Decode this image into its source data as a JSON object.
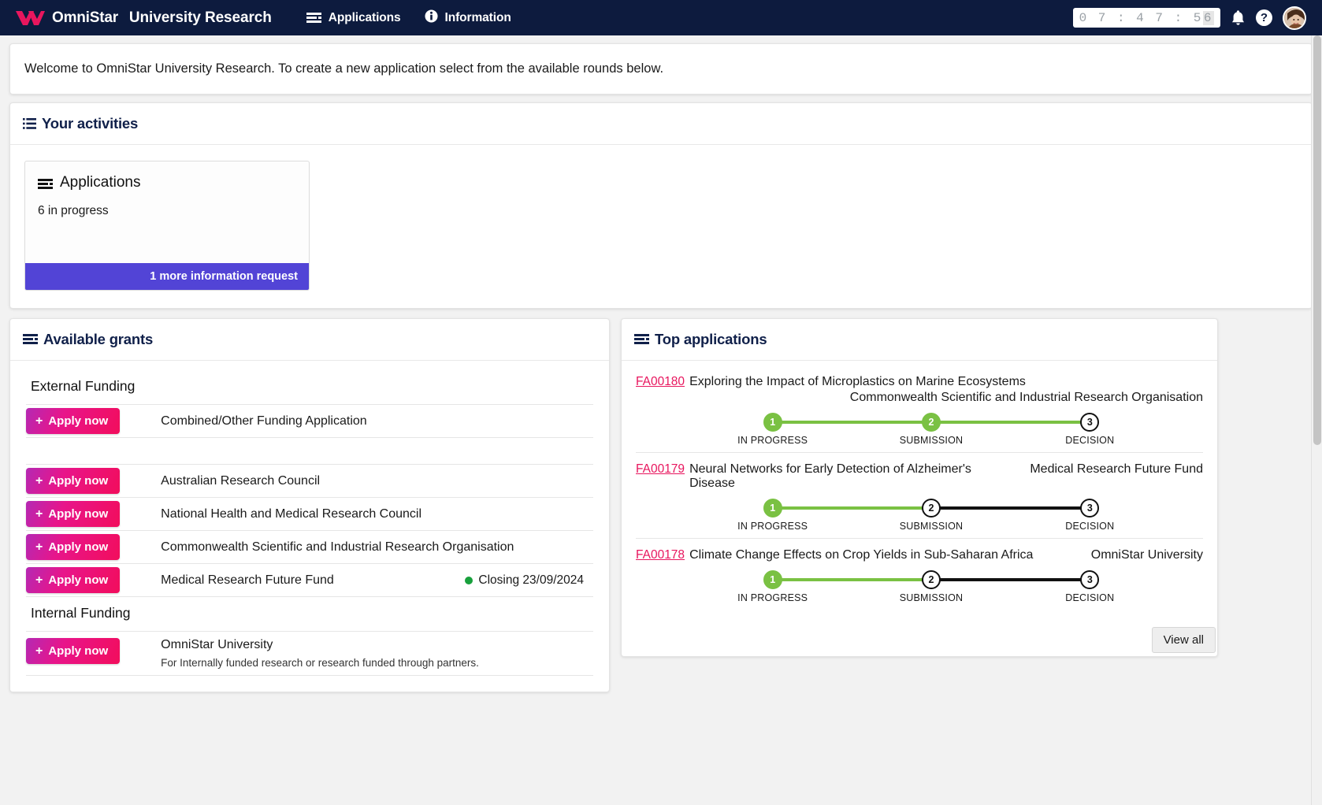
{
  "navbar": {
    "brand": "OmniStar",
    "brand_sub": "University Research",
    "links": [
      {
        "label": "Applications",
        "icon": "bars-icon"
      },
      {
        "label": "Information",
        "icon": "info-circle-icon"
      }
    ],
    "timer": "07:47:56",
    "timer_digits": "0 7 : 4 7 : 5 ",
    "timer_last": "6",
    "icons": [
      "bell-icon",
      "help-icon",
      "avatar"
    ],
    "help_label": "?"
  },
  "welcome": {
    "message": "Welcome to OmniStar University Research.  To create a new application select from the available rounds below."
  },
  "activities": {
    "title": "Your activities",
    "tile": {
      "title": "Applications",
      "subtitle": "6 in progress",
      "footer": "1 more information request"
    }
  },
  "grants": {
    "title": "Available grants",
    "groups": [
      {
        "name": "External Funding",
        "rows": [
          {
            "button": "Apply now",
            "name": "Combined/Other Funding Application",
            "desc": "",
            "closing": ""
          },
          {
            "spacer": true
          },
          {
            "button": "Apply now",
            "name": "Australian Research Council",
            "desc": "",
            "closing": ""
          },
          {
            "button": "Apply now",
            "name": "National Health and Medical Research Council",
            "desc": "",
            "closing": ""
          },
          {
            "button": "Apply now",
            "name": "Commonwealth Scientific and Industrial Research Organisation",
            "desc": "",
            "closing": ""
          },
          {
            "button": "Apply now",
            "name": "Medical Research Future Fund",
            "desc": "",
            "closing": "Closing 23/09/2024"
          }
        ]
      },
      {
        "name": "Internal Funding",
        "rows": [
          {
            "button": "Apply now",
            "name": "OmniStar University",
            "desc": "For Internally funded research or research funded through partners.",
            "closing": ""
          }
        ]
      }
    ]
  },
  "top_applications": {
    "title": "Top applications",
    "view_all": "View all",
    "step_labels": [
      "IN PROGRESS",
      "SUBMISSION",
      "DECISION"
    ],
    "items": [
      {
        "id": "FA00180",
        "title": "Exploring the Impact of Microplastics on Marine Ecosystems",
        "org": "Commonwealth Scientific and Industrial Research Organisation",
        "org_wrapped": true,
        "steps": [
          {
            "num": "1",
            "label": "IN PROGRESS",
            "state": "done"
          },
          {
            "num": "2",
            "label": "SUBMISSION",
            "state": "done"
          },
          {
            "num": "3",
            "label": "DECISION",
            "state": "todo"
          }
        ],
        "segments": [
          "green",
          "green"
        ]
      },
      {
        "id": "FA00179",
        "title": "Neural Networks for Early Detection of Alzheimer's Disease",
        "org": "Medical Research Future Fund",
        "org_wrapped": false,
        "steps": [
          {
            "num": "1",
            "label": "IN PROGRESS",
            "state": "done"
          },
          {
            "num": "2",
            "label": "SUBMISSION",
            "state": "todo"
          },
          {
            "num": "3",
            "label": "DECISION",
            "state": "todo"
          }
        ],
        "segments": [
          "green",
          "dark"
        ]
      },
      {
        "id": "FA00178",
        "title": "Climate Change Effects on Crop Yields in Sub-Saharan Africa",
        "org": "OmniStar University",
        "org_wrapped": false,
        "steps": [
          {
            "num": "1",
            "label": "IN PROGRESS",
            "state": "done"
          },
          {
            "num": "2",
            "label": "SUBMISSION",
            "state": "todo"
          },
          {
            "num": "3",
            "label": "DECISION",
            "state": "todo"
          }
        ],
        "segments": [
          "green",
          "dark"
        ]
      }
    ]
  },
  "colors": {
    "navy": "#0d1b3e",
    "accent_pink": "#e8165e",
    "purple": "#5244d6",
    "green": "#7ac143",
    "status_green": "#18a03c"
  }
}
